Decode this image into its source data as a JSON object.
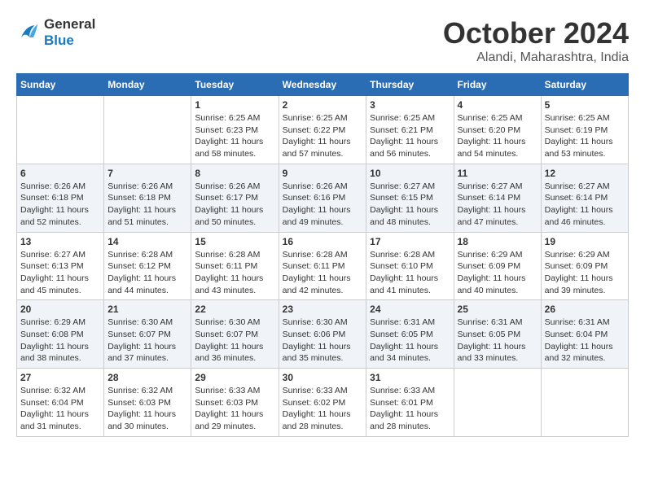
{
  "header": {
    "logo_line1": "General",
    "logo_line2": "Blue",
    "month": "October 2024",
    "location": "Alandi, Maharashtra, India"
  },
  "weekdays": [
    "Sunday",
    "Monday",
    "Tuesday",
    "Wednesday",
    "Thursday",
    "Friday",
    "Saturday"
  ],
  "weeks": [
    [
      {
        "day": "",
        "info": ""
      },
      {
        "day": "",
        "info": ""
      },
      {
        "day": "1",
        "info": "Sunrise: 6:25 AM\nSunset: 6:23 PM\nDaylight: 11 hours and 58 minutes."
      },
      {
        "day": "2",
        "info": "Sunrise: 6:25 AM\nSunset: 6:22 PM\nDaylight: 11 hours and 57 minutes."
      },
      {
        "day": "3",
        "info": "Sunrise: 6:25 AM\nSunset: 6:21 PM\nDaylight: 11 hours and 56 minutes."
      },
      {
        "day": "4",
        "info": "Sunrise: 6:25 AM\nSunset: 6:20 PM\nDaylight: 11 hours and 54 minutes."
      },
      {
        "day": "5",
        "info": "Sunrise: 6:25 AM\nSunset: 6:19 PM\nDaylight: 11 hours and 53 minutes."
      }
    ],
    [
      {
        "day": "6",
        "info": "Sunrise: 6:26 AM\nSunset: 6:18 PM\nDaylight: 11 hours and 52 minutes."
      },
      {
        "day": "7",
        "info": "Sunrise: 6:26 AM\nSunset: 6:18 PM\nDaylight: 11 hours and 51 minutes."
      },
      {
        "day": "8",
        "info": "Sunrise: 6:26 AM\nSunset: 6:17 PM\nDaylight: 11 hours and 50 minutes."
      },
      {
        "day": "9",
        "info": "Sunrise: 6:26 AM\nSunset: 6:16 PM\nDaylight: 11 hours and 49 minutes."
      },
      {
        "day": "10",
        "info": "Sunrise: 6:27 AM\nSunset: 6:15 PM\nDaylight: 11 hours and 48 minutes."
      },
      {
        "day": "11",
        "info": "Sunrise: 6:27 AM\nSunset: 6:14 PM\nDaylight: 11 hours and 47 minutes."
      },
      {
        "day": "12",
        "info": "Sunrise: 6:27 AM\nSunset: 6:14 PM\nDaylight: 11 hours and 46 minutes."
      }
    ],
    [
      {
        "day": "13",
        "info": "Sunrise: 6:27 AM\nSunset: 6:13 PM\nDaylight: 11 hours and 45 minutes."
      },
      {
        "day": "14",
        "info": "Sunrise: 6:28 AM\nSunset: 6:12 PM\nDaylight: 11 hours and 44 minutes."
      },
      {
        "day": "15",
        "info": "Sunrise: 6:28 AM\nSunset: 6:11 PM\nDaylight: 11 hours and 43 minutes."
      },
      {
        "day": "16",
        "info": "Sunrise: 6:28 AM\nSunset: 6:11 PM\nDaylight: 11 hours and 42 minutes."
      },
      {
        "day": "17",
        "info": "Sunrise: 6:28 AM\nSunset: 6:10 PM\nDaylight: 11 hours and 41 minutes."
      },
      {
        "day": "18",
        "info": "Sunrise: 6:29 AM\nSunset: 6:09 PM\nDaylight: 11 hours and 40 minutes."
      },
      {
        "day": "19",
        "info": "Sunrise: 6:29 AM\nSunset: 6:09 PM\nDaylight: 11 hours and 39 minutes."
      }
    ],
    [
      {
        "day": "20",
        "info": "Sunrise: 6:29 AM\nSunset: 6:08 PM\nDaylight: 11 hours and 38 minutes."
      },
      {
        "day": "21",
        "info": "Sunrise: 6:30 AM\nSunset: 6:07 PM\nDaylight: 11 hours and 37 minutes."
      },
      {
        "day": "22",
        "info": "Sunrise: 6:30 AM\nSunset: 6:07 PM\nDaylight: 11 hours and 36 minutes."
      },
      {
        "day": "23",
        "info": "Sunrise: 6:30 AM\nSunset: 6:06 PM\nDaylight: 11 hours and 35 minutes."
      },
      {
        "day": "24",
        "info": "Sunrise: 6:31 AM\nSunset: 6:05 PM\nDaylight: 11 hours and 34 minutes."
      },
      {
        "day": "25",
        "info": "Sunrise: 6:31 AM\nSunset: 6:05 PM\nDaylight: 11 hours and 33 minutes."
      },
      {
        "day": "26",
        "info": "Sunrise: 6:31 AM\nSunset: 6:04 PM\nDaylight: 11 hours and 32 minutes."
      }
    ],
    [
      {
        "day": "27",
        "info": "Sunrise: 6:32 AM\nSunset: 6:04 PM\nDaylight: 11 hours and 31 minutes."
      },
      {
        "day": "28",
        "info": "Sunrise: 6:32 AM\nSunset: 6:03 PM\nDaylight: 11 hours and 30 minutes."
      },
      {
        "day": "29",
        "info": "Sunrise: 6:33 AM\nSunset: 6:03 PM\nDaylight: 11 hours and 29 minutes."
      },
      {
        "day": "30",
        "info": "Sunrise: 6:33 AM\nSunset: 6:02 PM\nDaylight: 11 hours and 28 minutes."
      },
      {
        "day": "31",
        "info": "Sunrise: 6:33 AM\nSunset: 6:01 PM\nDaylight: 11 hours and 28 minutes."
      },
      {
        "day": "",
        "info": ""
      },
      {
        "day": "",
        "info": ""
      }
    ]
  ]
}
